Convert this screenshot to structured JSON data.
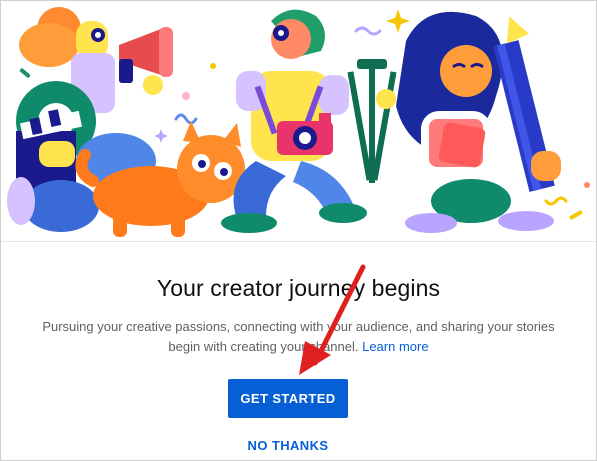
{
  "dialog": {
    "title": "Your creator journey begins",
    "description": "Pursuing your creative passions, connecting with your audience, and sharing your stories begin with creating your channel.",
    "learn_more_label": "Learn more",
    "primary_button_label": "GET STARTED",
    "secondary_button_label": "NO THANKS"
  },
  "colors": {
    "accent_blue": "#065fd4",
    "annotation_arrow": "#e02020",
    "title_text": "#0f0f0f",
    "body_text": "#606060"
  },
  "icons": {
    "annotation": "red-arrow-icon"
  }
}
